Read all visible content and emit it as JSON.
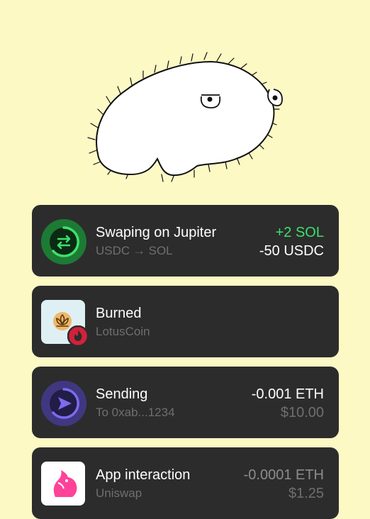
{
  "mascot": {
    "icon": "white-fuzzy-creature-illustration"
  },
  "activities": [
    {
      "icon": "swap-icon",
      "title": "Swaping on Jupiter",
      "subtitle": "USDC → SOL",
      "amount_primary": "+2 SOL",
      "amount_secondary": "-50 USDC",
      "primary_color": "#3ee06b",
      "secondary_color": "#ffffff"
    },
    {
      "icon": "lotus-coin-icon",
      "badge_icon": "burn-badge-icon",
      "title": "Burned",
      "subtitle": "LotusCoin"
    },
    {
      "icon": "send-icon",
      "title": "Sending",
      "subtitle": "To 0xab...1234",
      "amount_primary": "-0.001 ETH",
      "amount_secondary": "$10.00",
      "primary_color": "#ffffff",
      "secondary_color": "#6f6f6f"
    },
    {
      "icon": "uniswap-icon",
      "title": "App interaction",
      "subtitle": "Uniswap",
      "amount_primary": "-0.0001 ETH",
      "amount_secondary": "$1.25",
      "primary_color": "#ffffff",
      "secondary_color": "#6f6f6f"
    }
  ],
  "colors": {
    "background": "#fdf9c5",
    "card": "#2c2c2c",
    "swap_accent": "#3ee06b",
    "send_accent": "#7b6cf0",
    "burn_badge": "#d2223a"
  }
}
